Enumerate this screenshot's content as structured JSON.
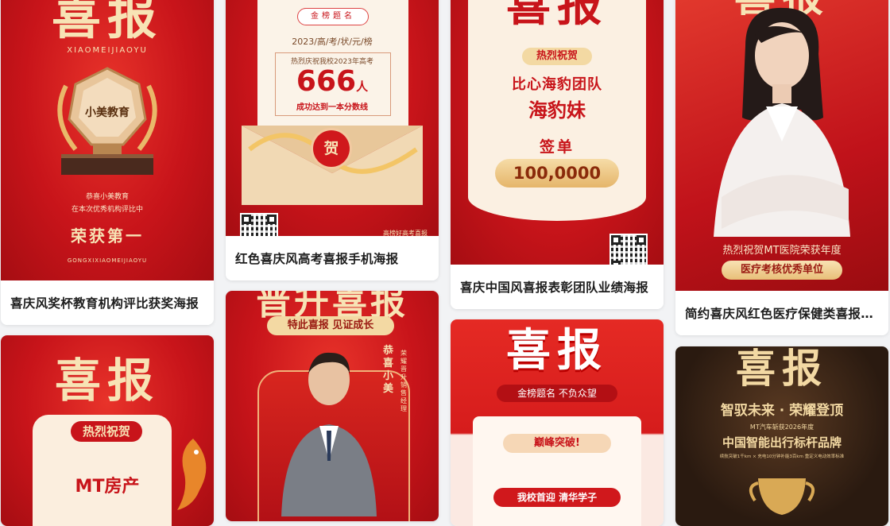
{
  "cards": [
    {
      "caption": "喜庆风奖杯教育机构评比获奖海报",
      "poster": {
        "headline": "喜报",
        "subline": "XIAOMEIJIAOYU",
        "trophy_text": "小美教育",
        "line1": "恭喜小美教育",
        "line2": "在本次优秀机构评比中",
        "award": "荣获第一",
        "footer": "GONGXIXIAOMEIJIAOYU"
      }
    },
    {
      "caption": "红色喜庆风高考喜报手机海报",
      "poster": {
        "tag": "金榜题名",
        "year_line": "2023/高/考/状/元/榜",
        "line1": "热烈庆祝我校2023年高考",
        "number": "666",
        "unit": "人",
        "line2": "成功达到一本分数线",
        "seal": "贺",
        "footer": "高榜好高考喜报"
      }
    },
    {
      "caption": "喜庆中国风喜报表彰团队业绩海报",
      "poster": {
        "headline": "喜报",
        "tag": "热烈祝贺",
        "team": "比心海豹团队",
        "name": "海豹妹",
        "label": "签单",
        "amount": "100,0000"
      }
    },
    {
      "caption": "简约喜庆风红色医疗保健类喜报海报",
      "poster": {
        "headline": "喜报",
        "line1": "热烈祝贺MT医院荣获年度",
        "award": "医疗考核优秀单位"
      }
    },
    {
      "caption": "",
      "poster": {
        "headline": "喜报",
        "tag": "热烈祝贺",
        "company": "MT房产"
      }
    },
    {
      "caption": "",
      "poster": {
        "headline": "晋升喜报",
        "banner": "特此喜报 见证成长",
        "name": "恭喜小美",
        "role": "荣耀晋升销售经理"
      }
    },
    {
      "caption": "",
      "poster": {
        "headline": "喜报",
        "banner": "金榜题名 不负众望",
        "ribbon": "巅峰突破!",
        "line1": "我校首迎 清华学子"
      }
    },
    {
      "caption": "",
      "poster": {
        "headline": "喜报",
        "slogan": "智驭未来 · 荣耀登顶",
        "small": "MT汽车斩获2026年度",
        "title": "中国智能出行标杆品牌",
        "tiny": "续航突破1千km × 充电10分钟补能3百km 重定义电动效率标准"
      }
    }
  ],
  "colors": {
    "brand_red": "#c8141a",
    "gold": "#f3d9a3",
    "caption_text": "#1d1d1d",
    "background": "#f2f3f5"
  }
}
